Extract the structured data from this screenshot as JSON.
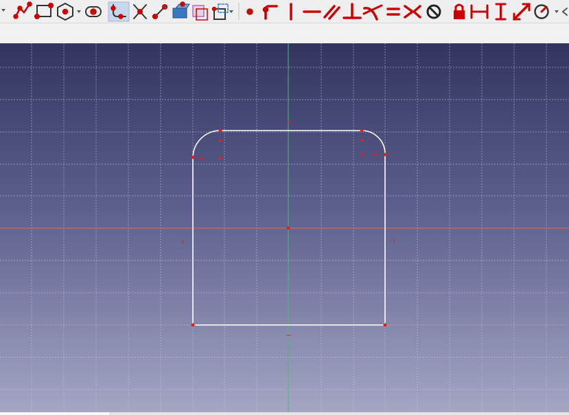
{
  "toolbar": {
    "groups": [
      {
        "name": "sketcher-geometries",
        "icons": [
          "polyline-icon",
          "rectangle-icon",
          "regular-polygon-icon",
          "slot-icon",
          "fillet-icon",
          "trim-icon",
          "extend-icon",
          "external-geometry-icon",
          "carbon-copy-icon",
          "construction-mode-icon"
        ]
      },
      {
        "name": "sketcher-constraints",
        "icons": [
          "constrain-coincident-icon",
          "constrain-point-on-object-icon",
          "constrain-vertical-icon",
          "constrain-horizontal-icon",
          "constrain-parallel-icon",
          "constrain-perpendicular-icon",
          "constrain-tangent-icon",
          "constrain-equal-icon",
          "constrain-symmetric-icon",
          "constrain-block-icon",
          "constrain-lock-icon",
          "constrain-horizontal-distance-icon",
          "constrain-vertical-distance-icon",
          "constrain-distance-icon",
          "constrain-radius-icon"
        ]
      }
    ],
    "accent_color": "#cc0000",
    "active_tool": "fillet"
  },
  "viewport": {
    "background_top": "#333560",
    "background_bottom": "#a4a6c3",
    "grid": true,
    "x_axis_color": "#e06a5a",
    "y_axis_color": "#45c06a",
    "sketch_color": "#ffffff",
    "constraint_color": "#e02020",
    "sketch": {
      "shape": "rounded-top rectangle",
      "fillet_corners": [
        "top-left",
        "top-right"
      ]
    }
  }
}
